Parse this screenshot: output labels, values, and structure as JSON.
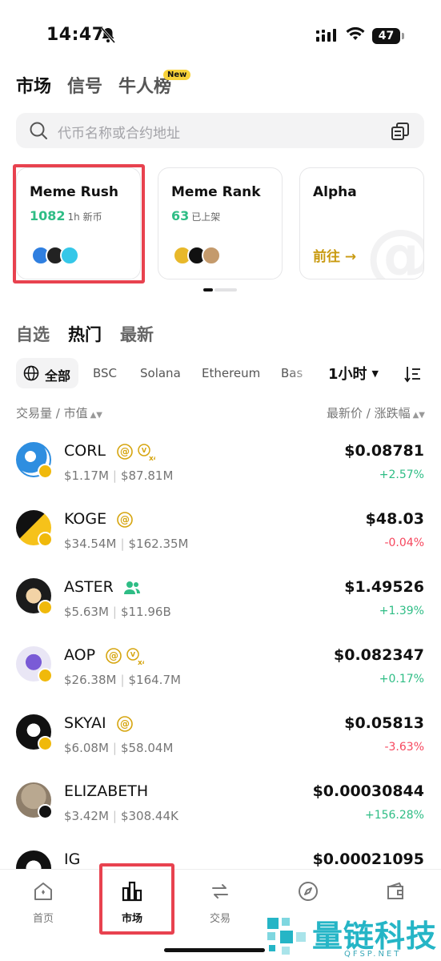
{
  "status_bar": {
    "time": "14:47",
    "battery": "47"
  },
  "top_tabs": [
    {
      "label": "市场",
      "active": true
    },
    {
      "label": "信号",
      "active": false
    },
    {
      "label": "牛人榜",
      "active": false,
      "badge": "New"
    }
  ],
  "search": {
    "placeholder": "代币名称或合约地址"
  },
  "cards": [
    {
      "title": "Meme Rush",
      "count": "1082",
      "count_note": "1h 新币"
    },
    {
      "title": "Meme Rank",
      "count": "63",
      "count_note": "已上架"
    },
    {
      "title": "Alpha",
      "cta": "前往 →"
    }
  ],
  "section_tabs": [
    {
      "label": "自选",
      "active": false
    },
    {
      "label": "热门",
      "active": true
    },
    {
      "label": "最新",
      "active": false
    }
  ],
  "chains": {
    "all_label": "全部",
    "items": [
      "BSC",
      "Solana",
      "Ethereum",
      "Bas"
    ]
  },
  "time_filter": "1小时",
  "columns": {
    "left": "交易量 / 市值",
    "right": "最新价 / 涨跌幅"
  },
  "tokens": [
    {
      "symbol": "CORL",
      "volume": "$1.17M",
      "mcap": "$87.81M",
      "price": "$0.08781",
      "change": "+2.57%",
      "direction": "up",
      "tags": [
        "at",
        "x4"
      ]
    },
    {
      "symbol": "KOGE",
      "volume": "$34.54M",
      "mcap": "$162.35M",
      "price": "$48.03",
      "change": "-0.04%",
      "direction": "down",
      "tags": [
        "at"
      ]
    },
    {
      "symbol": "ASTER",
      "volume": "$5.63M",
      "mcap": "$11.96B",
      "price": "$1.49526",
      "change": "+1.39%",
      "direction": "up",
      "tags": [
        "community"
      ]
    },
    {
      "symbol": "AOP",
      "volume": "$26.38M",
      "mcap": "$164.7M",
      "price": "$0.082347",
      "change": "+0.17%",
      "direction": "up",
      "tags": [
        "at",
        "x4"
      ]
    },
    {
      "symbol": "SKYAI",
      "volume": "$6.08M",
      "mcap": "$58.04M",
      "price": "$0.05813",
      "change": "-3.63%",
      "direction": "down",
      "tags": [
        "at"
      ]
    },
    {
      "symbol": "ELIZABETH",
      "volume": "$3.42M",
      "mcap": "$308.44K",
      "price": "$0.00030844",
      "change": "+156.28%",
      "direction": "up",
      "tags": []
    },
    {
      "symbol": "IG",
      "price": "$0.00021095"
    }
  ],
  "bottom_nav": [
    {
      "label": "首页",
      "icon": "home-icon",
      "active": false
    },
    {
      "label": "市场",
      "icon": "market-icon",
      "active": true
    },
    {
      "label": "交易",
      "icon": "swap-icon",
      "active": false
    },
    {
      "label": "",
      "icon": "compass-icon",
      "active": false
    },
    {
      "label": "",
      "icon": "wallet-icon",
      "active": false
    }
  ],
  "watermark": {
    "text": "量链科技",
    "sub": "QFSP.NET"
  },
  "colors": {
    "up": "#2ebd85",
    "down": "#f6465d",
    "highlight": "#e8424f",
    "accent_gold": "#c99a10",
    "watermark": "#25b5c6"
  }
}
